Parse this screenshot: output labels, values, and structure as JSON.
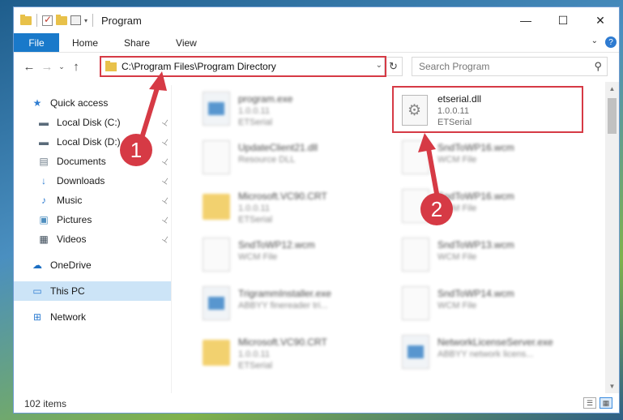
{
  "window": {
    "title": "Program",
    "controls": {
      "minimize": "—",
      "maximize": "☐",
      "close": "✕"
    }
  },
  "ribbon": {
    "tabs": [
      "File",
      "Home",
      "Share",
      "View"
    ],
    "expand_icon": "chevron-down-icon",
    "help": "?"
  },
  "navbar": {
    "back": "←",
    "forward": "→",
    "recent": "⌄",
    "up": "↑",
    "address": "C:\\Program Files\\Program Directory",
    "refresh": "↻",
    "search_placeholder": "Search Program",
    "search_icon": "⚲"
  },
  "sidebar": {
    "items": [
      {
        "label": "Quick access",
        "icon": "★",
        "color": "#2f7dd1",
        "pinned": false
      },
      {
        "label": "Local Disk (C:)",
        "icon": "▬",
        "color": "#5a6b7a",
        "pinned": true
      },
      {
        "label": "Local Disk (D:)",
        "icon": "▬",
        "color": "#5a6b7a",
        "pinned": true
      },
      {
        "label": "Documents",
        "icon": "▤",
        "color": "#6d7b88",
        "pinned": true
      },
      {
        "label": "Downloads",
        "icon": "↓",
        "color": "#2f7dd1",
        "pinned": true
      },
      {
        "label": "Music",
        "icon": "♪",
        "color": "#2f7dd1",
        "pinned": true
      },
      {
        "label": "Pictures",
        "icon": "▣",
        "color": "#4f8fbf",
        "pinned": true
      },
      {
        "label": "Videos",
        "icon": "▦",
        "color": "#3b4a58",
        "pinned": true
      },
      {
        "label": "OneDrive",
        "icon": "☁",
        "color": "#1b6ec2",
        "pinned": false
      },
      {
        "label": "This PC",
        "icon": "▭",
        "color": "#2f7dd1",
        "pinned": false
      },
      {
        "label": "Network",
        "icon": "⊞",
        "color": "#2f7dd1",
        "pinned": false
      }
    ],
    "pin_glyph": "📌"
  },
  "files": [
    {
      "name": "program.exe",
      "line2": "1.0.0.11",
      "line3": "ETSerial",
      "kind": "app",
      "blurred": true
    },
    {
      "name": "etserial.dll",
      "line2": "1.0.0.11",
      "line3": "ETSerial",
      "kind": "dll",
      "blurred": false
    },
    {
      "name": "UpdateClient21.dll",
      "line2": "Resource DLL",
      "line3": "",
      "kind": "dll",
      "blurred": true
    },
    {
      "name": "SndToWP16.wcm",
      "line2": "WCM File",
      "line3": "",
      "kind": "doc",
      "blurred": true
    },
    {
      "name": "Microsoft.VC90.CRT",
      "line2": "1.0.0.11",
      "line3": "ETSerial",
      "kind": "folder",
      "blurred": true
    },
    {
      "name": "SndToWP16.wcm",
      "line2": "WCM File",
      "line3": "",
      "kind": "doc",
      "blurred": true
    },
    {
      "name": "SndToWP12.wcm",
      "line2": "WCM File",
      "line3": "",
      "kind": "doc",
      "blurred": true
    },
    {
      "name": "SndToWP13.wcm",
      "line2": "WCM File",
      "line3": "",
      "kind": "doc",
      "blurred": true
    },
    {
      "name": "TrigrammInstaller.exe",
      "line2": "ABBYY finereader tri...",
      "line3": "",
      "kind": "app",
      "blurred": true
    },
    {
      "name": "SndToWP14.wcm",
      "line2": "WCM File",
      "line3": "",
      "kind": "doc",
      "blurred": true
    },
    {
      "name": "Microsoft.VC90.CRT",
      "line2": "1.0.0.11",
      "line3": "ETSerial",
      "kind": "folder",
      "blurred": true
    },
    {
      "name": "NetworkLicenseServer.exe",
      "line2": "ABBYY network licens...",
      "line3": "",
      "kind": "app",
      "blurred": true
    }
  ],
  "status": {
    "count": "102 items"
  },
  "annotations": {
    "step1": "1",
    "step2": "2",
    "color": "#d63a45"
  }
}
